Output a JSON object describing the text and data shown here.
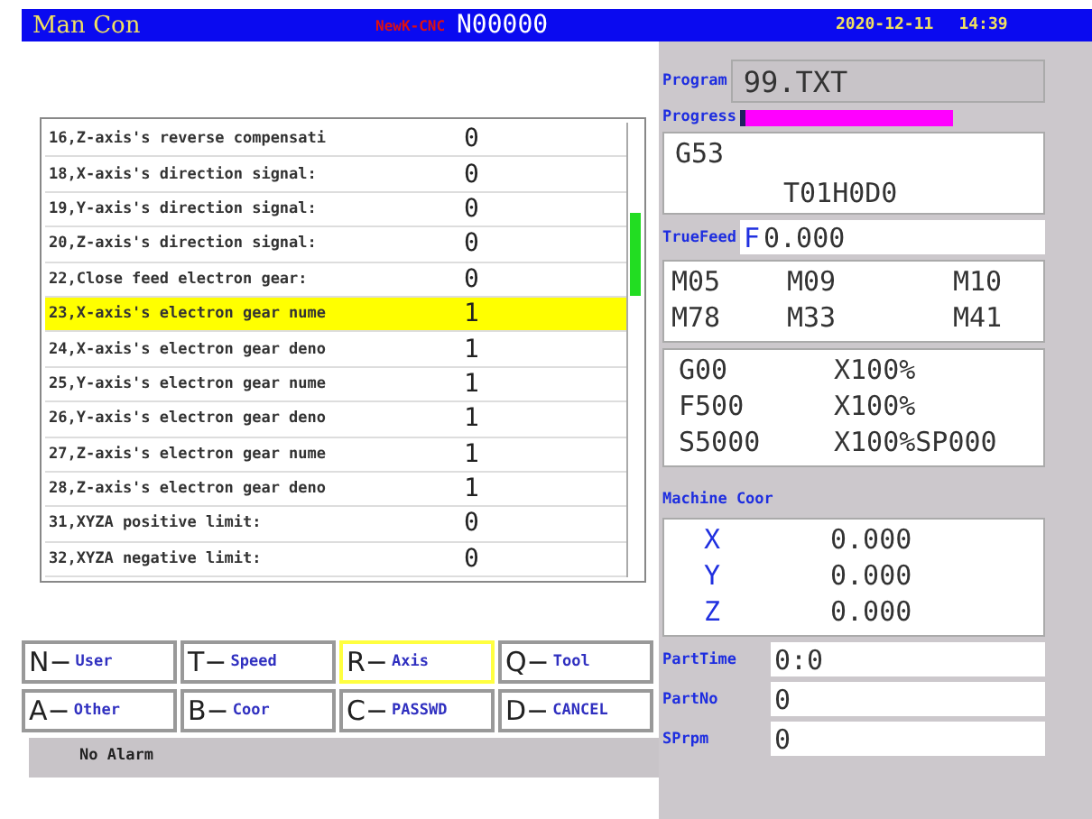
{
  "header": {
    "mode": "Man Con",
    "brand": "NewK-CNC",
    "line": "N00000",
    "date": "2020-12-11",
    "time": "14:39"
  },
  "params": [
    {
      "label": "16,Z-axis's reverse compensati",
      "value": "0",
      "selected": false
    },
    {
      "label": "18,X-axis's direction signal:",
      "value": "0",
      "selected": false
    },
    {
      "label": "19,Y-axis's direction signal:",
      "value": "0",
      "selected": false
    },
    {
      "label": "20,Z-axis's direction signal:",
      "value": "0",
      "selected": false
    },
    {
      "label": "22,Close feed electron gear:",
      "value": "0",
      "selected": false
    },
    {
      "label": "23,X-axis's electron gear nume",
      "value": "1",
      "selected": true
    },
    {
      "label": "24,X-axis's electron gear deno",
      "value": "1",
      "selected": false
    },
    {
      "label": "25,Y-axis's electron gear nume",
      "value": "1",
      "selected": false
    },
    {
      "label": "26,Y-axis's electron gear deno",
      "value": "1",
      "selected": false
    },
    {
      "label": "27,Z-axis's electron gear nume",
      "value": "1",
      "selected": false
    },
    {
      "label": "28,Z-axis's electron gear deno",
      "value": "1",
      "selected": false
    },
    {
      "label": "31,XYZA positive limit:",
      "value": "0",
      "selected": false
    },
    {
      "label": "32,XYZA negative limit:",
      "value": "0",
      "selected": false
    }
  ],
  "softkeys": [
    {
      "key": "N−",
      "label": "User",
      "selected": false
    },
    {
      "key": "T−",
      "label": "Speed",
      "selected": false
    },
    {
      "key": "R−",
      "label": "Axis",
      "selected": true
    },
    {
      "key": "Q−",
      "label": "Tool",
      "selected": false
    },
    {
      "key": "A−",
      "label": "Other",
      "selected": false
    },
    {
      "key": "B−",
      "label": "Coor",
      "selected": false
    },
    {
      "key": "C−",
      "label": "PASSWD",
      "selected": false
    },
    {
      "key": "D−",
      "label": "CANCEL",
      "selected": false
    }
  ],
  "alarm": "No Alarm",
  "program": {
    "label": "Program",
    "value": "99.TXT"
  },
  "progress": {
    "label": "Progress",
    "level": 0.03
  },
  "modal": {
    "line1": "G53",
    "line2": "T01H0D0"
  },
  "true_feed": {
    "label": "TrueFeed",
    "prefix": "F",
    "value": "0.000"
  },
  "m_codes": [
    "M05",
    "M09",
    "M10",
    "M78",
    "M33",
    "M41"
  ],
  "overrides": [
    {
      "code": "G00",
      "value": "X100%"
    },
    {
      "code": "F500",
      "value": "X100%"
    },
    {
      "code": "S5000",
      "value": "X100%SP000"
    }
  ],
  "machine_coor": {
    "label": "Machine Coor",
    "axes": [
      {
        "axis": "X",
        "value": "0.000"
      },
      {
        "axis": "Y",
        "value": "0.000"
      },
      {
        "axis": "Z",
        "value": "0.000"
      }
    ]
  },
  "stats": [
    {
      "label": "PartTime",
      "value": "0:0"
    },
    {
      "label": "PartNo",
      "value": "0"
    },
    {
      "label": "SPrpm",
      "value": "0"
    }
  ]
}
